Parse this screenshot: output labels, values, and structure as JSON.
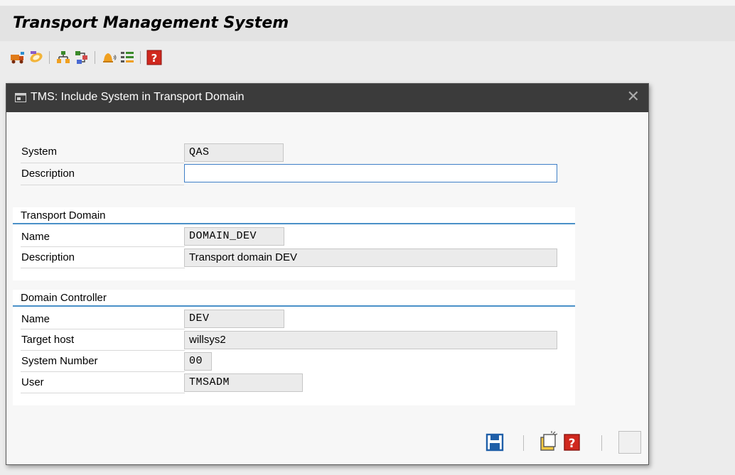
{
  "app": {
    "title": "Transport Management System"
  },
  "toolbar": {
    "icons": [
      "transport-truck-icon",
      "transport-routes-icon",
      "system-overview-icon",
      "transport-routes-config-icon",
      "alert-bell-icon",
      "import-queue-icon",
      "help-icon"
    ]
  },
  "dialog": {
    "title": "TMS: Include System in Transport Domain",
    "system_label": "System",
    "system_value": "QAS",
    "description_label": "Description",
    "description_value": "",
    "transport_domain": {
      "heading": "Transport Domain",
      "name_label": "Name",
      "name_value": "DOMAIN_DEV",
      "description_label": "Description",
      "description_value": "Transport domain DEV"
    },
    "domain_controller": {
      "heading": "Domain Controller",
      "name_label": "Name",
      "name_value": "DEV",
      "target_host_label": "Target host",
      "target_host_value": "willsys2",
      "system_number_label": "System Number",
      "system_number_value": "00",
      "user_label": "User",
      "user_value": "TMSADM"
    },
    "footer_icons": [
      "save-icon",
      "new-entry-icon",
      "help-icon",
      "empty-button"
    ]
  },
  "colors": {
    "dialog_header": "#3b3b3b",
    "group_underline": "#4a90c8",
    "help_red": "#d0281e",
    "toolbar_orange": "#e8a21a"
  }
}
